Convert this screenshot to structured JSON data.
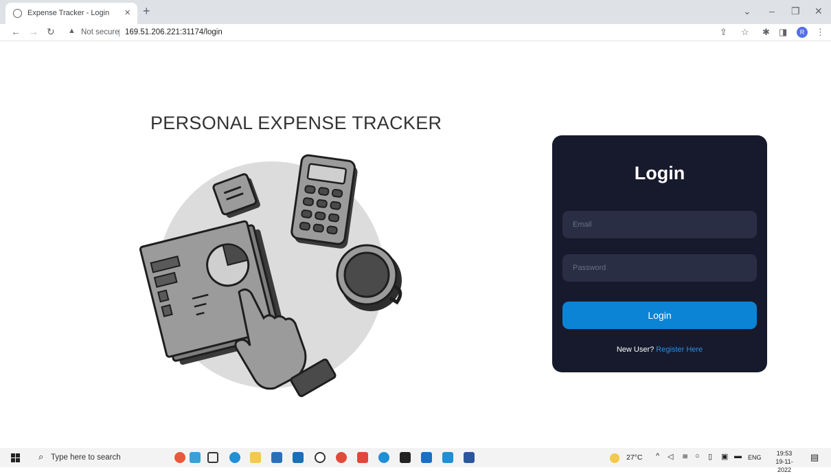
{
  "browser": {
    "tab_title": "Expense Tracker - Login",
    "tab_close": "×",
    "new_tab": "+",
    "address_security": "Not secure",
    "address_url": "169.51.206.221:31174/login",
    "profile_initial": "R"
  },
  "page": {
    "heading": "PERSONAL EXPENSE TRACKER",
    "login_card": {
      "title": "Login",
      "email_placeholder": "Email",
      "password_placeholder": "Password",
      "login_button": "Login",
      "new_user_text": "New User?",
      "register_link": "Register Here"
    }
  },
  "taskbar": {
    "search_placeholder": "Type here to search",
    "weather": "27°C",
    "language": "ENG",
    "time": "19:53",
    "date": "19-11-2022"
  },
  "colors": {
    "card_bg": "#171a2c",
    "input_bg": "#2a2e45",
    "button_bg": "#0b84d6",
    "link": "#2d8de0"
  }
}
